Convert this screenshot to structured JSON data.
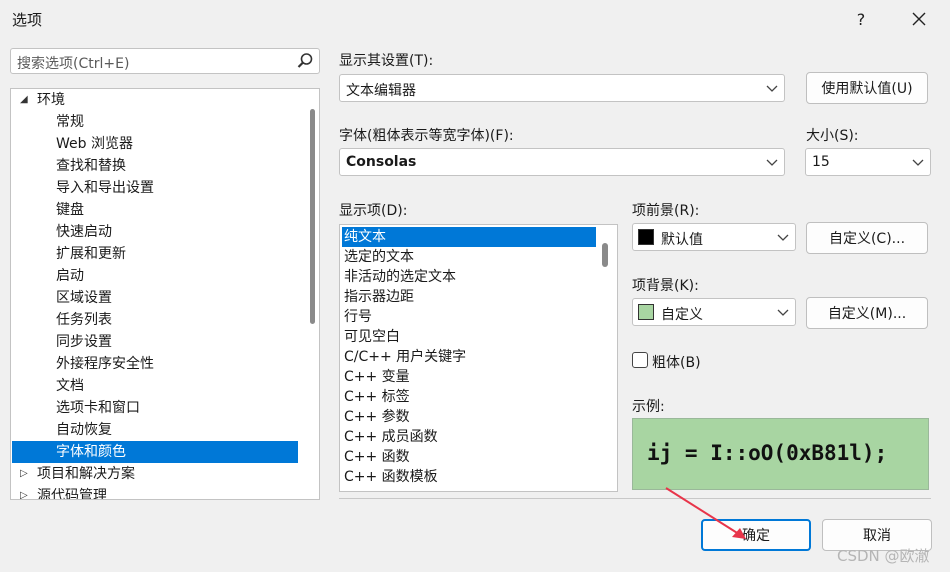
{
  "window": {
    "title": "选项",
    "help_label": "?",
    "close_label": "✕"
  },
  "search": {
    "placeholder": "搜索选项(Ctrl+E)"
  },
  "tree": {
    "items": [
      {
        "label": "环境",
        "expanded": true
      },
      {
        "label": "常规"
      },
      {
        "label": "Web 浏览器"
      },
      {
        "label": "查找和替换"
      },
      {
        "label": "导入和导出设置"
      },
      {
        "label": "键盘"
      },
      {
        "label": "快速启动"
      },
      {
        "label": "扩展和更新"
      },
      {
        "label": "启动"
      },
      {
        "label": "区域设置"
      },
      {
        "label": "任务列表"
      },
      {
        "label": "同步设置"
      },
      {
        "label": "外接程序安全性"
      },
      {
        "label": "文档"
      },
      {
        "label": "选项卡和窗口"
      },
      {
        "label": "自动恢复"
      },
      {
        "label": "字体和颜色",
        "selected": true
      },
      {
        "label": "项目和解决方案",
        "expanded": false
      },
      {
        "label": "源代码管理",
        "expanded": false
      }
    ]
  },
  "settings": {
    "show_settings_label": "显示其设置(T):",
    "show_settings_value": "文本编辑器",
    "use_defaults_label": "使用默认值(U)",
    "font_label": "字体(粗体表示等宽字体)(F):",
    "font_value": "Consolas",
    "size_label": "大小(S):",
    "size_value": "15",
    "display_items_label": "显示项(D):",
    "display_items": [
      "纯文本",
      "选定的文本",
      "非活动的选定文本",
      "指示器边距",
      "行号",
      "可见空白",
      "C/C++ 用户关键字",
      "C++ 变量",
      "C++ 标签",
      "C++ 参数",
      "C++ 成员函数",
      "C++ 函数",
      "C++ 函数模板"
    ],
    "selected_display_item": "纯文本",
    "foreground_label": "项前景(R):",
    "foreground_value": "默认值",
    "foreground_color": "#000000",
    "foreground_custom_label": "自定义(C)...",
    "background_label": "项背景(K):",
    "background_value": "自定义",
    "background_color": "#a8d5a2",
    "background_custom_label": "自定义(M)...",
    "bold_label": "粗体(B)",
    "bold_checked": false,
    "sample_label": "示例:",
    "sample_text": "ij = I::oO(0xB81l);"
  },
  "footer": {
    "ok_label": "确定",
    "cancel_label": "取消"
  },
  "watermark": "CSDN @欧澈",
  "colors": {
    "accent": "#0078d7",
    "annotation_arrow": "#e8354a"
  }
}
